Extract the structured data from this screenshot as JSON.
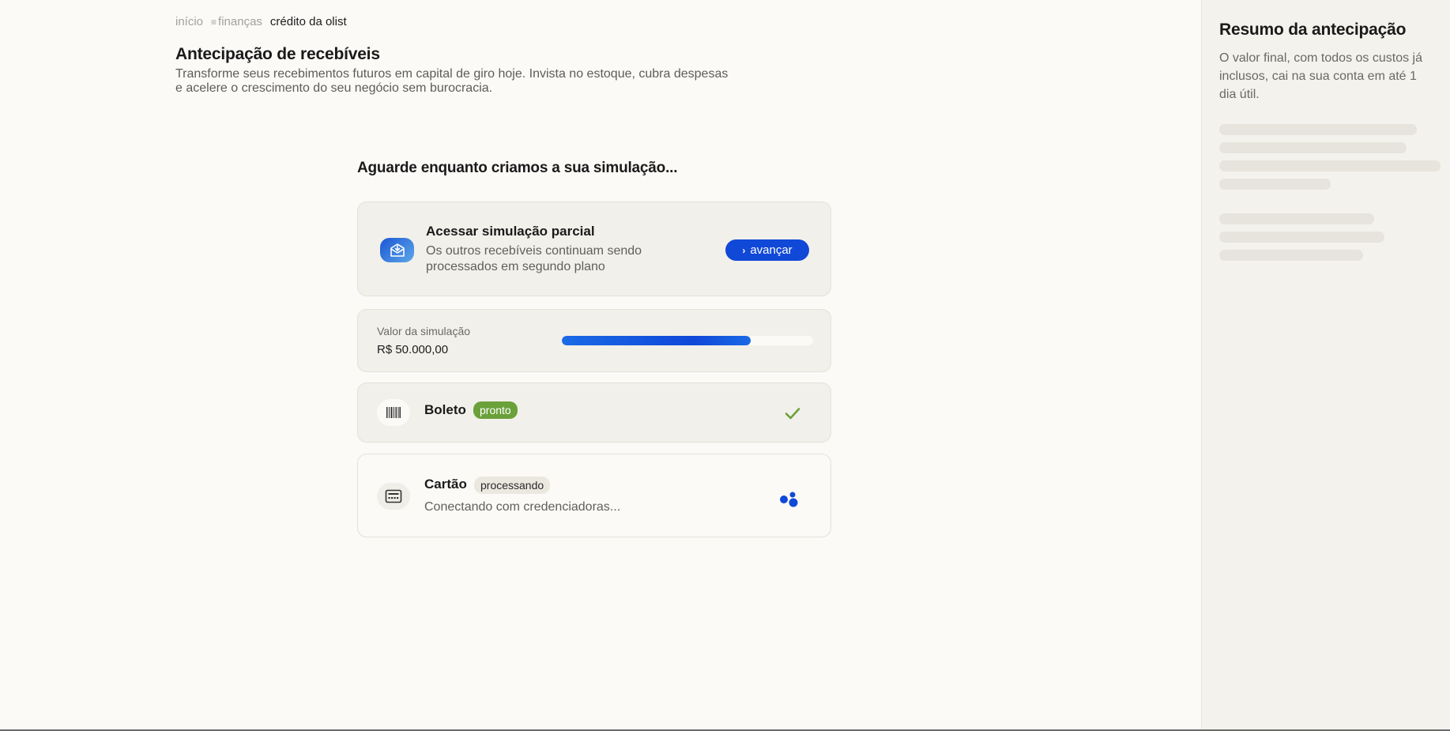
{
  "breadcrumb": {
    "items": [
      "início",
      "finanças"
    ],
    "current": "crédito da olist"
  },
  "page": {
    "title": "Antecipação de recebíveis",
    "description": "Transforme seus recebimentos futuros em capital de giro hoje. Invista no estoque, cubra despesas e acelere o crescimento do seu negócio sem burocracia."
  },
  "simulation": {
    "heading": "Aguarde enquanto criamos a sua simulação...",
    "partial": {
      "title": "Acessar simulação parcial",
      "description": "Os outros recebíveis continuam sendo processados em segundo plano",
      "button_label": "avançar"
    },
    "value": {
      "label": "Valor da simulação",
      "amount": "R$ 50.000,00",
      "progress_percent": 75
    },
    "boleto": {
      "title": "Boleto",
      "status": "pronto"
    },
    "cartao": {
      "title": "Cartão",
      "status": "processando",
      "description": "Conectando com credenciadoras..."
    }
  },
  "summary": {
    "title": "Resumo da antecipação",
    "text": "O valor final, com todos os custos já inclusos, cai na sua conta em até 1 dia útil."
  },
  "colors": {
    "accent": "#1048d8",
    "success": "#6aa13a",
    "background": "#fbfaf7",
    "sidebar_bg": "#f4f2ec"
  },
  "icons": {
    "partial": "download-mail-icon",
    "boleto": "barcode-icon",
    "cartao": "card-terminal-icon",
    "ready": "check-icon",
    "loading": "loading-dots-icon"
  }
}
